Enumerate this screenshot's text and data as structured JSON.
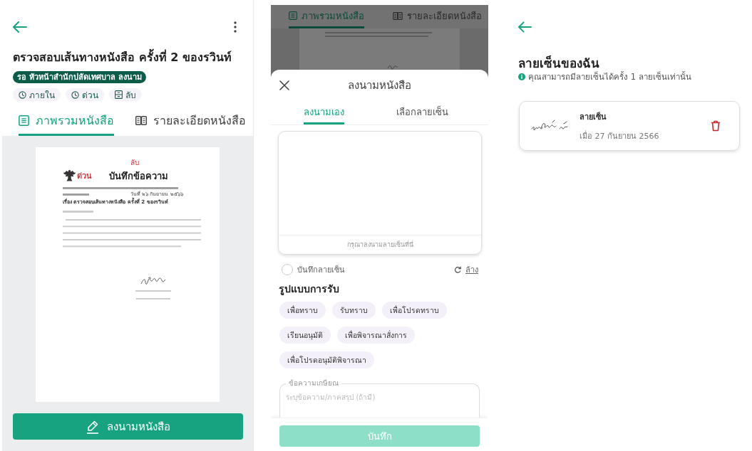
{
  "document_screen": {
    "title": "ตรวจสอบเส้นทางหนังสือ ครั้งที่ 2 ของรวินท์",
    "status_badge": "รอ หัวหน้าสำนักปลัดเทศบาล ลงนาม",
    "tags": [
      {
        "label": "ภายใน",
        "kind": "clock"
      },
      {
        "label": "ด่วน",
        "kind": "clock"
      },
      {
        "label": "ลับ",
        "kind": "drawer"
      }
    ],
    "tabs": [
      {
        "label": "ภาพรวมหนังสือ",
        "kind": "list",
        "selected": true
      },
      {
        "label": "รายละเอียดหนังสือ",
        "kind": "book",
        "selected": false
      }
    ],
    "document": {
      "secrecy": "ลับ",
      "urgency": "ด่วน",
      "heading": "บันทึกข้อความ",
      "date": "วันที่ ๒๖ กันยายน ๒๕๖๖",
      "subject": "เรื่อง  ตรวจสอบเส้นทางหนังสือ ครั้งที่ 2 ของรวินท์"
    },
    "sign_button": "ลงนามหนังสือ"
  },
  "sign_sheet_screen": {
    "background_tabs": [
      {
        "label": "ภาพรวมหนังสือ",
        "kind": "list",
        "selected": true
      },
      {
        "label": "รายละเอียดหนังสือ",
        "kind": "book",
        "selected": false
      }
    ],
    "title": "ลงนามหนังสือ",
    "tabs": [
      {
        "label": "ลงนามเอง",
        "selected": true
      },
      {
        "label": "เลือกลายเซ็น",
        "selected": false
      }
    ],
    "signature_pad": {
      "hint": "กรุณาลงนามลายเซ็นที่นี่"
    },
    "save_signature": {
      "label": "บันทึกลายเซ็น",
      "checked": false
    },
    "clear_link": "ล้าง",
    "receive_format": {
      "heading": "รูปแบบการรับ",
      "options": [
        {
          "label": "เพื่อทราบ",
          "selected": false
        },
        {
          "label": "รับทราบ",
          "selected": false
        },
        {
          "label": "เพื่อโปรดทราบ",
          "selected": false
        },
        {
          "label": "เรียนอนุมัติ",
          "selected": false
        },
        {
          "label": "เพื่อพิจารณาสั่งการ",
          "selected": false
        },
        {
          "label": "เพื่อโปรดอนุมัติพิจารณา",
          "selected": false
        }
      ]
    },
    "note_field": {
      "label": "ข้อความเกษียณ",
      "placeholder": "ระบุข้อความ/ภาคสรุป (ถ้ามี)"
    },
    "save_button": {
      "label": "บันทึก",
      "disabled": true
    }
  },
  "my_signatures_screen": {
    "title": "ลายเซ็นของฉัน",
    "info": "คุณสามารถมีลายเซ็นได้ครั้ง 1 ลายเซ็นเท่านั้น",
    "signatures": [
      {
        "label": "ลายเซ็น",
        "date": "เมื่อ 27 กันยายน 2566"
      }
    ]
  }
}
